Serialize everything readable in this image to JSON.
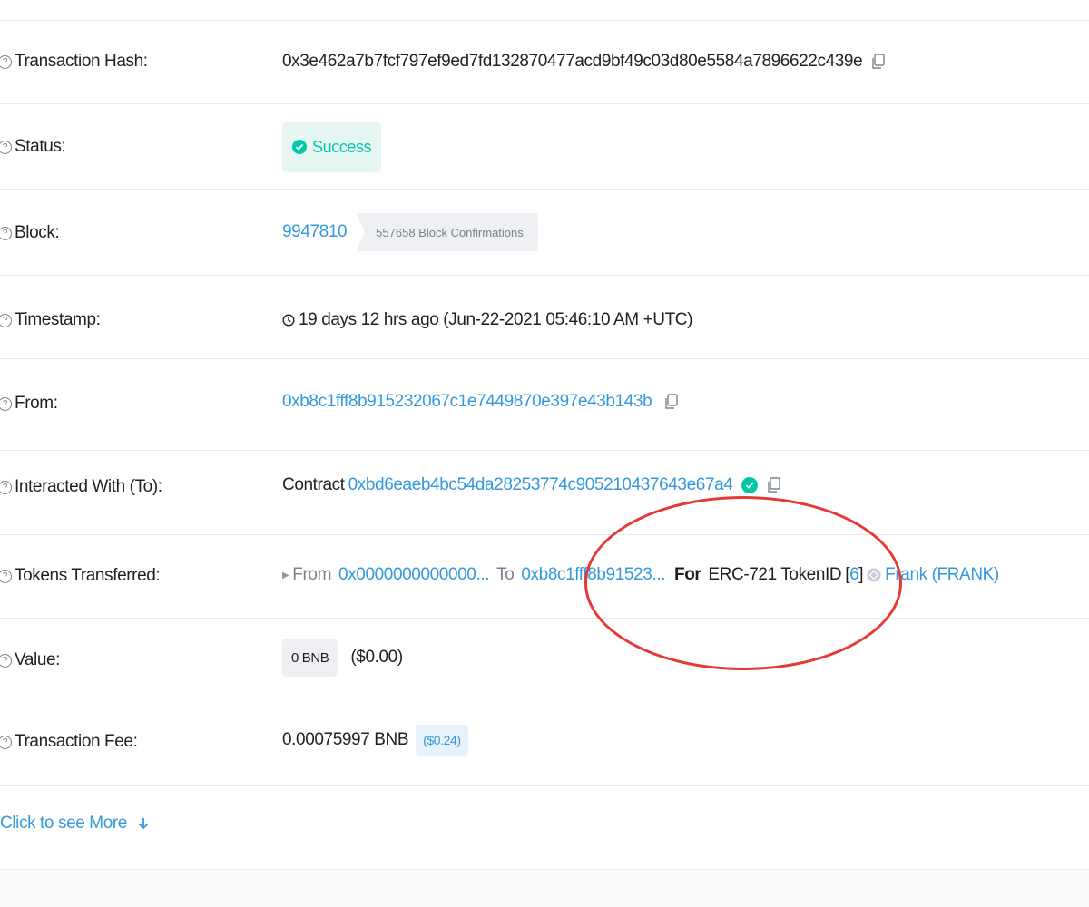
{
  "rows": {
    "hash": {
      "label": "Transaction Hash:",
      "value": "0x3e462a7b7fcf797ef9ed7fd132870477acd9bf49c03d80e5584a7896622c439e"
    },
    "status": {
      "label": "Status:",
      "value": "Success"
    },
    "block": {
      "label": "Block:",
      "number": "9947810",
      "confirmations": "557658 Block Confirmations"
    },
    "timestamp": {
      "label": "Timestamp:",
      "value": "19 days 12 hrs ago (Jun-22-2021 05:46:10 AM +UTC)"
    },
    "from": {
      "label": "From:",
      "value": "0xb8c1fff8b915232067c1e7449870e397e43b143b"
    },
    "to": {
      "label": "Interacted With (To):",
      "prefix": "Contract",
      "value": "0xbd6eaeb4bc54da28253774c905210437643e67a4"
    },
    "tokens": {
      "label": "Tokens Transferred:",
      "from_label": "From",
      "from_value": "0x0000000000000...",
      "to_label": "To",
      "to_value": "0xb8c1fff8b91523...",
      "for_label": "For",
      "standard": "ERC-721 TokenID",
      "token_id": "6",
      "token_name": "Frank (FRANK)"
    },
    "value": {
      "label": "Value:",
      "amount": "0 BNB",
      "usd": "($0.00)"
    },
    "fee": {
      "label": "Transaction Fee:",
      "amount": "0.00075997 BNB",
      "usd": "($0.24)"
    }
  },
  "more_link": "Click to see More",
  "colors": {
    "link": "#3498db",
    "success": "#00c9a7",
    "annotation": "#e53935"
  }
}
